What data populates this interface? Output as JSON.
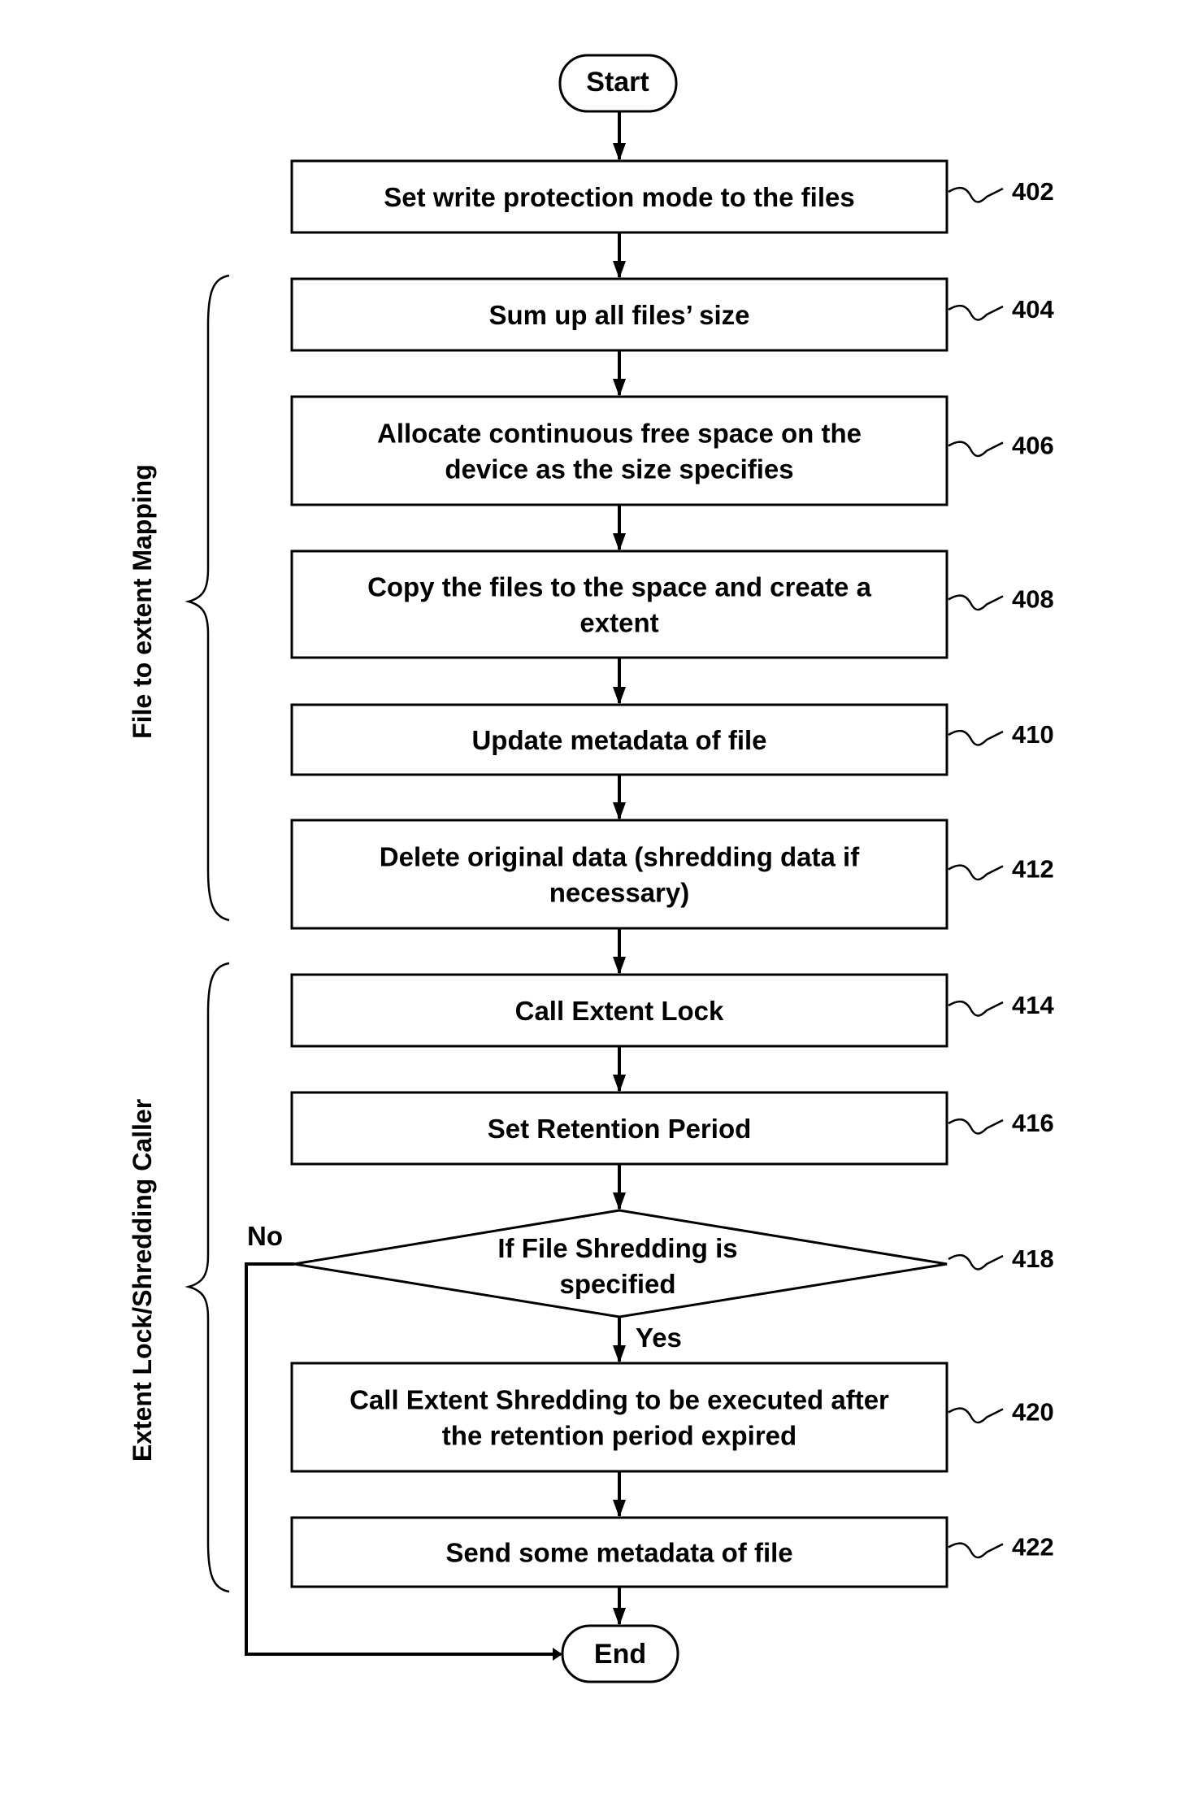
{
  "start": {
    "label": "Start"
  },
  "end": {
    "label": "End"
  },
  "steps": [
    {
      "ref": "402",
      "lines": [
        "Set write protection mode to the files"
      ]
    },
    {
      "ref": "404",
      "lines": [
        "Sum up all files’ size"
      ]
    },
    {
      "ref": "406",
      "lines": [
        "Allocate continuous free space on the",
        "device as the size specifies"
      ]
    },
    {
      "ref": "408",
      "lines": [
        "Copy the files to the space and create a",
        "extent"
      ]
    },
    {
      "ref": "410",
      "lines": [
        "Update metadata of file"
      ]
    },
    {
      "ref": "412",
      "lines": [
        "Delete original data (shredding data if",
        "necessary)"
      ]
    },
    {
      "ref": "414",
      "lines": [
        "Call Extent Lock"
      ]
    },
    {
      "ref": "416",
      "lines": [
        "Set Retention Period"
      ]
    }
  ],
  "decision": {
    "ref": "418",
    "lines": [
      "If File Shredding is",
      "specified"
    ],
    "yes_label": "Yes",
    "no_label": "No"
  },
  "after_steps": [
    {
      "ref": "420",
      "lines": [
        "Call Extent Shredding to be executed after",
        "the retention period expired"
      ]
    },
    {
      "ref": "422",
      "lines": [
        "Send some metadata of file"
      ]
    }
  ],
  "groups": [
    {
      "label": "File  to extent Mapping"
    },
    {
      "label": "Extent Lock/Shredding Caller"
    }
  ]
}
